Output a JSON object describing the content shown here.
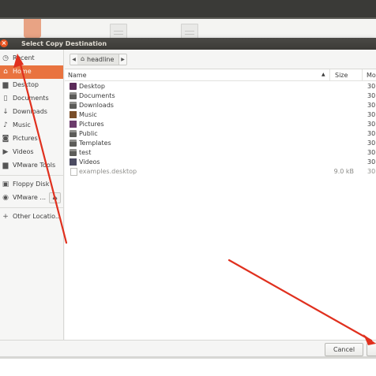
{
  "dialog": {
    "title": "Select Copy Destination",
    "close_label": "×"
  },
  "sidebar": {
    "items": [
      {
        "label": "Recent",
        "icon": "clock-icon"
      },
      {
        "label": "Home",
        "icon": "home-icon",
        "selected": true
      },
      {
        "label": "Desktop",
        "icon": "folder-icon"
      },
      {
        "label": "Documents",
        "icon": "document-icon"
      },
      {
        "label": "Downloads",
        "icon": "download-icon"
      },
      {
        "label": "Music",
        "icon": "music-icon"
      },
      {
        "label": "Pictures",
        "icon": "camera-icon"
      },
      {
        "label": "Videos",
        "icon": "video-icon"
      },
      {
        "label": "VMware Tools",
        "icon": "folder-icon"
      },
      {
        "label": "Floppy Disk",
        "icon": "floppy-icon"
      },
      {
        "label": "VMware ...",
        "icon": "disc-icon"
      },
      {
        "label": "Other Locatio...",
        "icon": "plus-icon"
      }
    ]
  },
  "pathbar": {
    "current": "headline"
  },
  "filelist": {
    "columns": {
      "name": "Name",
      "size": "Size",
      "modified": "Mo"
    },
    "rows": [
      {
        "name": "Desktop",
        "size": "",
        "modified": "30"
      },
      {
        "name": "Documents",
        "size": "",
        "modified": "30"
      },
      {
        "name": "Downloads",
        "size": "",
        "modified": "30"
      },
      {
        "name": "Music",
        "size": "",
        "modified": "30"
      },
      {
        "name": "Pictures",
        "size": "",
        "modified": "30"
      },
      {
        "name": "Public",
        "size": "",
        "modified": "30"
      },
      {
        "name": "Templates",
        "size": "",
        "modified": "30"
      },
      {
        "name": "test",
        "size": "",
        "modified": "30"
      },
      {
        "name": "Videos",
        "size": "",
        "modified": "30"
      },
      {
        "name": "examples.desktop",
        "size": "9.0 kB",
        "modified": "30"
      }
    ]
  },
  "footer": {
    "cancel_label": "Cancel"
  },
  "colors": {
    "accent": "#e9733f",
    "titlebar": "#3c3b37",
    "annotation": "#e0301e"
  }
}
